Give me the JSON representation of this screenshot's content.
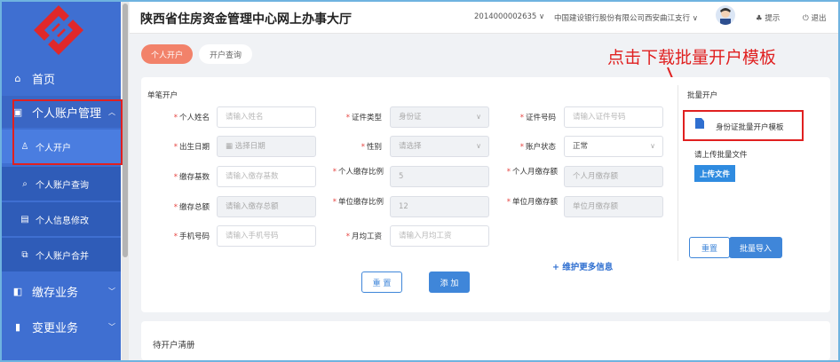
{
  "header": {
    "title": "陕西省住房资金管理中心网上办事大厅",
    "account": "2014000002635",
    "bank": "中国建设银行股份有限公司西安曲江支行",
    "notice": "提示",
    "logout": "退出"
  },
  "sidebar": {
    "home": "首页",
    "personal_account": "个人账户管理",
    "sub_items": [
      "个人开户",
      "个人账户查询",
      "个人信息修改",
      "个人账户合并"
    ],
    "deposit": "缴存业务",
    "change": "变更业务"
  },
  "tabs": [
    "个人开户",
    "开户查询"
  ],
  "form": {
    "section": "单笔开户",
    "rows": [
      [
        {
          "label": "个人姓名",
          "placeholder": "请输入姓名"
        },
        {
          "label": "证件类型",
          "placeholder": "身份证"
        },
        {
          "label": "证件号码",
          "placeholder": "请输入证件号码"
        }
      ],
      [
        {
          "label": "出生日期",
          "placeholder": "选择日期"
        },
        {
          "label": "性别",
          "placeholder": "请选择"
        },
        {
          "label": "账户状态",
          "placeholder": "正常"
        }
      ],
      [
        {
          "label": "缴存基数",
          "placeholder": "请输入缴存基数"
        },
        {
          "label": "个人缴存比例",
          "placeholder": "5"
        },
        {
          "label": "个人月缴存额",
          "placeholder": "个人月缴存额"
        }
      ],
      [
        {
          "label": "缴存总额",
          "placeholder": "请输入缴存总额"
        },
        {
          "label": "单位缴存比例",
          "placeholder": "12"
        },
        {
          "label": "单位月缴存额",
          "placeholder": "单位月缴存额"
        }
      ],
      [
        {
          "label": "手机号码",
          "placeholder": "请输入手机号码"
        },
        {
          "label": "月均工资",
          "placeholder": "请输入月均工资"
        }
      ]
    ],
    "more": "+ 维护更多信息",
    "reset": "重 置",
    "add": "添 加"
  },
  "batch": {
    "section": "批量开户",
    "template": "身份证批量开户模板",
    "upload_prompt": "请上传批量文件",
    "upload": "上传文件",
    "reset": "重置",
    "import": "批量导入"
  },
  "pending_title": "待开户清册",
  "annotation": "点击下载批量开户模板"
}
